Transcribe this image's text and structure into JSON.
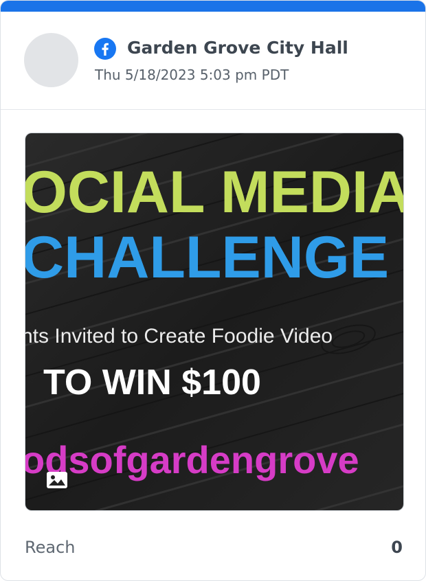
{
  "post": {
    "page_name": "Garden Grove City Hall",
    "timestamp": "Thu 5/18/2023 5:03 pm PDT",
    "platform_icon": "facebook-icon",
    "media_type_icon": "image-icon"
  },
  "image": {
    "line1": "OCIAL MEDIA",
    "line2": "CHALLENGE",
    "line3": "nts Invited to Create Foodie Video",
    "line4": "TO WIN $100",
    "line5": "odsofgardengrove"
  },
  "metric": {
    "label": "Reach",
    "value": "0"
  },
  "colors": {
    "accent": "#1a73e8",
    "facebook": "#1877f2",
    "headline_green": "#c3dd5c",
    "headline_blue": "#2f9ce8",
    "hashtag_magenta": "#d63cc6"
  }
}
